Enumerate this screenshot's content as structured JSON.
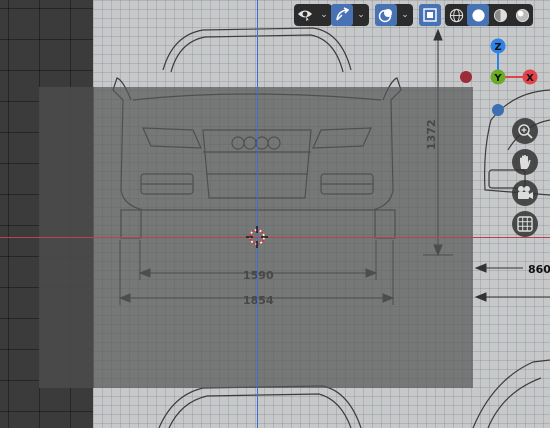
{
  "app": "3D Viewport",
  "header": {
    "buttons": [
      {
        "name": "visibility-selectability",
        "icon": "eye-cursor-icon"
      },
      {
        "name": "show-gizmo",
        "icon": "gizmo-arrow-icon",
        "active": true
      },
      {
        "name": "show-overlays",
        "icon": "overlay-circles-icon",
        "active": true
      },
      {
        "name": "toggle-xray",
        "icon": "xray-square-icon",
        "active": true
      },
      {
        "name": "shading-wireframe",
        "icon": "wireframe-sphere-icon"
      },
      {
        "name": "shading-solid",
        "icon": "solid-sphere-icon",
        "active": true
      },
      {
        "name": "shading-material",
        "icon": "material-sphere-icon"
      },
      {
        "name": "shading-rendered",
        "icon": "rendered-sphere-icon"
      }
    ]
  },
  "gizmo": {
    "z_label": "Z",
    "y_label": "Y",
    "x_label": "X",
    "colors": {
      "x": "#e2434b",
      "y": "#6cab26",
      "z": "#2f83e6",
      "neg_x": "#9c2c38",
      "neg_y": "#3b6fb0"
    }
  },
  "nav_tools": [
    {
      "name": "zoom-tool",
      "icon": "magnifier-plus-icon"
    },
    {
      "name": "pan-tool",
      "icon": "hand-icon"
    },
    {
      "name": "camera-view-tool",
      "icon": "camera-icon"
    },
    {
      "name": "toggle-ortho-tool",
      "icon": "grid-icon"
    }
  ],
  "blueprint_dimensions": {
    "height": "1372",
    "track_width": "1590",
    "overall_width": "1854",
    "side_partial": "860"
  },
  "colors": {
    "axis_x": "#b7434f",
    "axis_y": "#3b6fd6",
    "button_active": "#4772b3"
  }
}
